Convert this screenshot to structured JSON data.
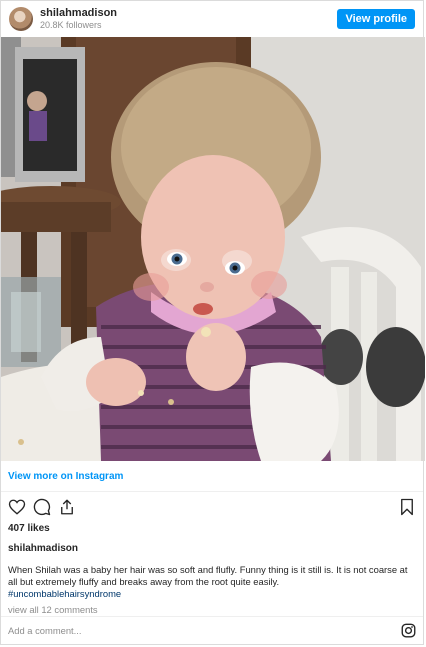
{
  "header": {
    "username": "shilahmadison",
    "followers": "20.8K followers",
    "view_profile_label": "View profile"
  },
  "photo": {
    "description_icon": "baby-photo"
  },
  "view_more_label": "View more on Instagram",
  "actions": {
    "like_icon": "heart-icon",
    "comment_icon": "comment-icon",
    "share_icon": "share-icon",
    "save_icon": "bookmark-icon"
  },
  "likes": "407 likes",
  "post": {
    "username": "shilahmadison",
    "caption": "When Shilah was a baby her hair was so soft and flufly. Funny thing is it still is. It is not coarse at all but extremely fluffy and breaks away from the root quite easily.",
    "hashtag": "#uncombablehairsyndrome",
    "view_comments": "view all 12 comments"
  },
  "comment_bar": {
    "placeholder": "Add a comment...",
    "logo_icon": "instagram-icon"
  },
  "colors": {
    "accent": "#0095f6",
    "text": "#262626",
    "muted": "#8e8e8e"
  }
}
